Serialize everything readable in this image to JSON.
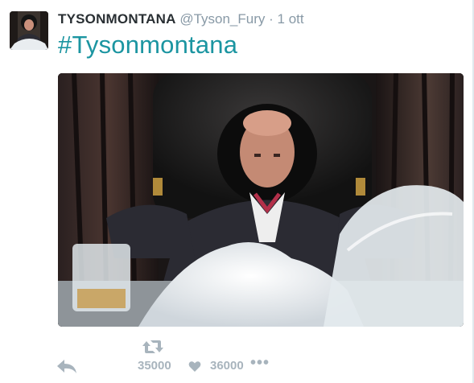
{
  "tweet": {
    "display_name": "TYSONMONTANA",
    "username": "@Tyson_Fury",
    "separator": "·",
    "time": "1 ott",
    "text": "#Tysonmontana"
  },
  "actions": {
    "retweet_count": "35000",
    "like_count": "36000",
    "more": "•••"
  },
  "icons": [
    "reply-icon",
    "retweet-icon",
    "heart-icon",
    "more-icon"
  ],
  "colors": {
    "hashtag": "#1b95a1",
    "name": "#292f33",
    "muted": "#8899a6",
    "action": "#a8b4bd"
  }
}
